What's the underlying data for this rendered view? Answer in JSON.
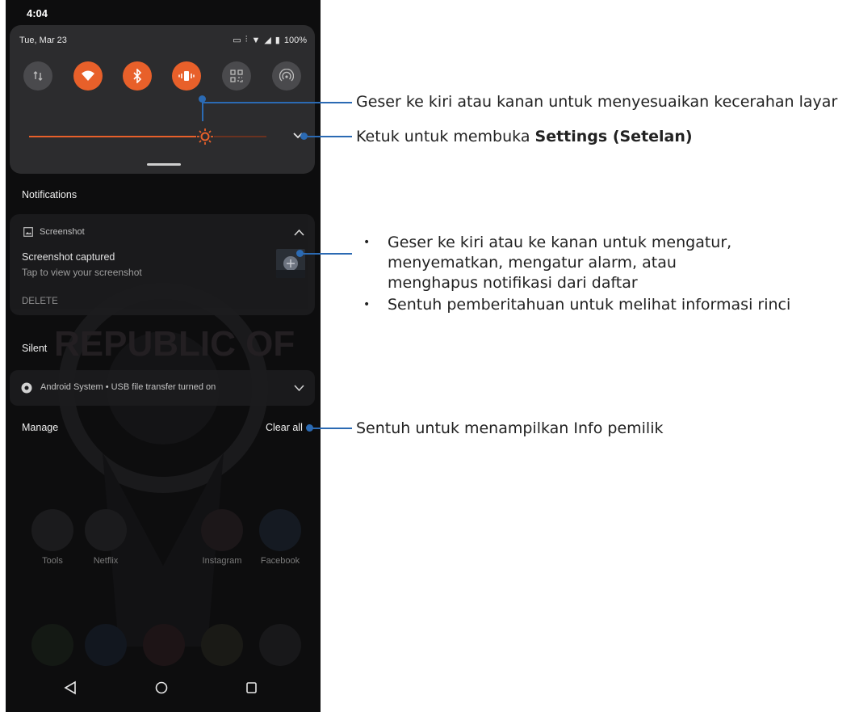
{
  "status": {
    "time": "4:04",
    "date": "Tue, Mar 23",
    "battery": "100%"
  },
  "quick_settings": {
    "tiles": [
      {
        "icon": "data-arrows-icon",
        "state": "off"
      },
      {
        "icon": "wifi-icon",
        "state": "on"
      },
      {
        "icon": "bluetooth-icon",
        "state": "on"
      },
      {
        "icon": "vibrate-icon",
        "state": "on"
      },
      {
        "icon": "qr-scan-icon",
        "state": "off"
      },
      {
        "icon": "hotspot-icon",
        "state": "off"
      }
    ],
    "brightness": 0.74
  },
  "notifications": {
    "header": "Notifications",
    "screenshot": {
      "app": "Screenshot",
      "title": "Screenshot captured",
      "body": "Tap to view your screenshot",
      "action": "DELETE"
    },
    "silent_header": "Silent",
    "usb": "Android System • USB file transfer turned on",
    "manage": "Manage",
    "clear_all": "Clear all"
  },
  "home": {
    "background_text": "REPUBLIC OF",
    "apps": [
      "Tools",
      "Netflix",
      "Instagram",
      "Facebook"
    ]
  },
  "callouts": {
    "brightness": "Geser ke kiri atau kanan untuk menyesuaikan kecerahan layar",
    "settings_prefix": "Ketuk untuk membuka ",
    "settings_bold": "Settings (Setelan)",
    "notif_bullets": [
      "Geser ke kiri atau ke kanan untuk mengatur, menyematkan, mengatur alarm, atau menghapus notifikasi dari daftar",
      "Sentuh pemberitahuan untuk melihat informasi rinci"
    ],
    "clear_all": "Sentuh untuk menampilkan Info pemilik"
  },
  "colors": {
    "accent": "#e8602a",
    "callout": "#2b6ab3"
  }
}
